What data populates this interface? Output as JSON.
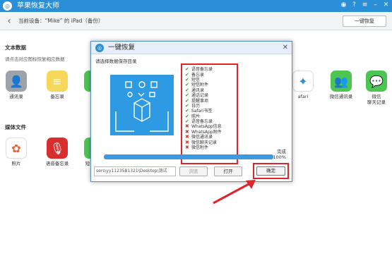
{
  "app": {
    "title": "苹果恢复大师",
    "logo_icon": "recovery-logo-icon"
  },
  "window_controls": [
    "weibo-icon",
    "help-icon",
    "menu-icon",
    "minimize-icon",
    "close-icon"
  ],
  "toolbar": {
    "device_label": "当前设备：“Mike” 的 iPad（备份）",
    "restore_button": "一键恢复"
  },
  "text_section": {
    "title": "文本数据",
    "hint": "请点击对应图标恢复相应数据",
    "apps": [
      {
        "label": "通讯录",
        "icon": "contacts-icon"
      },
      {
        "label": "备忘录",
        "icon": "notes-icon"
      },
      {
        "label": "afari",
        "icon": "safari-icon"
      },
      {
        "label": "微信通讯录",
        "icon": "wechat-contacts-icon"
      },
      {
        "label": "微信\n聊天记录",
        "icon": "wechat-chat-icon"
      }
    ]
  },
  "media_section": {
    "title": "媒体文件",
    "apps": [
      {
        "label": "照片",
        "icon": "photos-icon"
      },
      {
        "label": "语音备忘录",
        "icon": "voice-memo-icon"
      },
      {
        "label": "短",
        "icon": "messages-icon"
      }
    ]
  },
  "dialog": {
    "title": "一键恢复",
    "subtitle": "请选择数据保存目录",
    "items": [
      {
        "label": "语音备忘录",
        "status": "ok"
      },
      {
        "label": "备忘录",
        "status": "ok"
      },
      {
        "label": "短信",
        "status": "ok"
      },
      {
        "label": "短信附件",
        "status": "ok"
      },
      {
        "label": "通讯录",
        "status": "ok"
      },
      {
        "label": "通话记录",
        "status": "ok"
      },
      {
        "label": "提醒事项",
        "status": "ok"
      },
      {
        "label": "日历",
        "status": "ok"
      },
      {
        "label": "Safari书签",
        "status": "ok"
      },
      {
        "label": "照片",
        "status": "ok"
      },
      {
        "label": "语音备忘录",
        "status": "ok"
      },
      {
        "label": "WhatsApp信息",
        "status": "no"
      },
      {
        "label": "WhatsApp附件",
        "status": "no"
      },
      {
        "label": "微信通讯录",
        "status": "no"
      },
      {
        "label": "微信聊天记录",
        "status": "no"
      },
      {
        "label": "微信附件",
        "status": "no"
      }
    ],
    "progress": {
      "status": "完成",
      "percent_label": "100%",
      "value": 1.0
    },
    "path_value": "sers\\yy1123581321\\Desktop\\测试",
    "browse_button": "浏览",
    "open_button": "打开",
    "ok_button": "确定"
  },
  "colors": {
    "accent": "#2b8fd8",
    "highlight": "#e0242b",
    "ok": "#3aa53a",
    "fail": "#d9342b"
  }
}
